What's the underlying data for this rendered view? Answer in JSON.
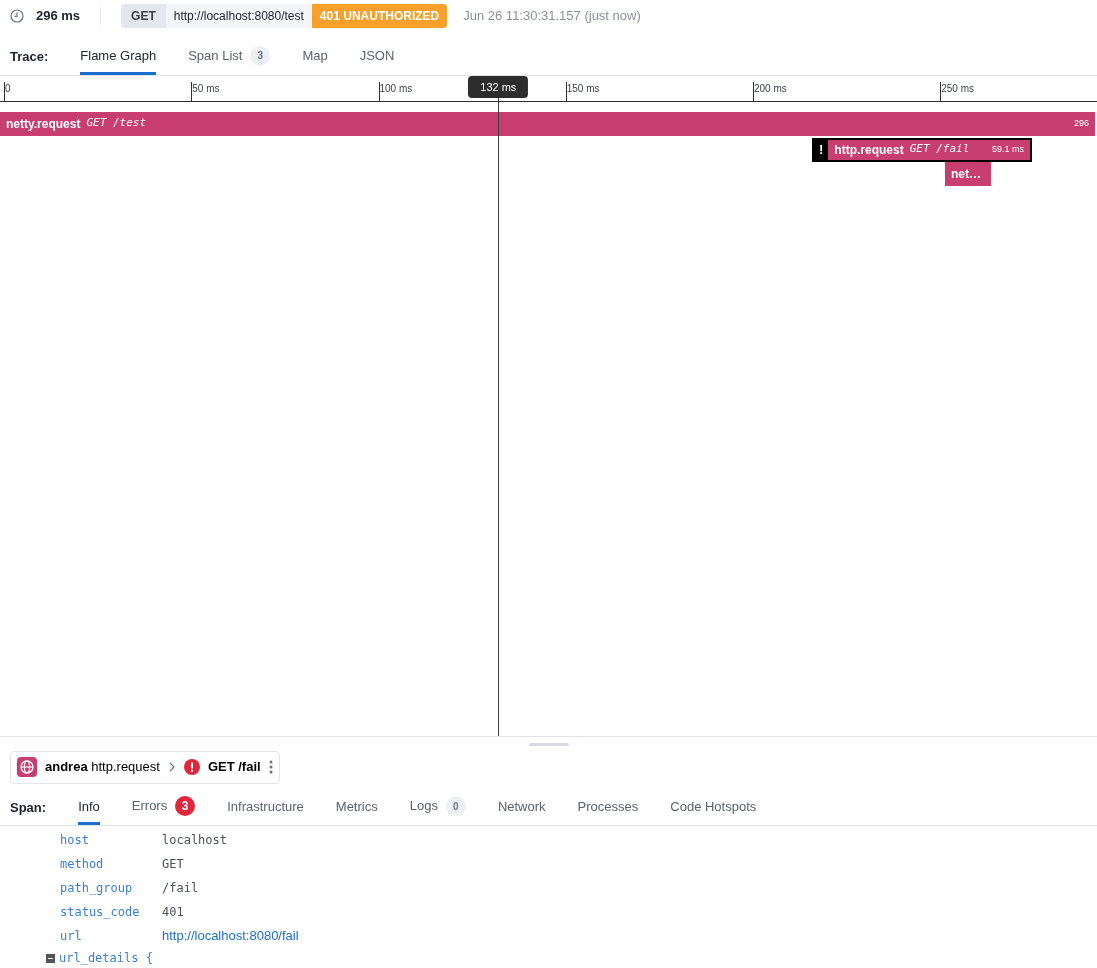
{
  "summary": {
    "duration": "296 ms",
    "method": "GET",
    "url": "http://localhost:8080/test",
    "status": "401 UNAUTHORIZED",
    "timestamp": "Jun 26 11:30:31.157 (just now)"
  },
  "trace_tabs": {
    "label": "Trace:",
    "tabs": [
      {
        "label": "Flame Graph",
        "selected": true
      },
      {
        "label": "Span List",
        "count": "3",
        "selected": false
      },
      {
        "label": "Map",
        "selected": false
      },
      {
        "label": "JSON",
        "selected": false
      }
    ]
  },
  "ruler": {
    "ticks": [
      "0",
      "50 ms",
      "100 ms",
      "150 ms",
      "200 ms",
      "250 ms"
    ],
    "cursor": "132 ms"
  },
  "spans": [
    {
      "name": "netty.request",
      "resource": "GET /test",
      "duration": "296",
      "error": false,
      "children": [
        {
          "name": "http.request",
          "resource": "GET /fail",
          "duration": "59.1 ms",
          "error": true,
          "error_mark": "!",
          "children": [
            {
              "name": "net…",
              "error": false
            }
          ]
        }
      ]
    }
  ],
  "span_header": {
    "service": "andrea",
    "operation": "http.request",
    "resource": "GET /fail",
    "error": true
  },
  "span_tabs": {
    "label": "Span:",
    "tabs": [
      {
        "label": "Info",
        "selected": true
      },
      {
        "label": "Errors",
        "count": "3",
        "alert": true,
        "selected": false
      },
      {
        "label": "Infrastructure",
        "selected": false
      },
      {
        "label": "Metrics",
        "selected": false
      },
      {
        "label": "Logs",
        "count": "0",
        "alert": false,
        "selected": false
      },
      {
        "label": "Network",
        "selected": false
      },
      {
        "label": "Processes",
        "selected": false
      },
      {
        "label": "Code Hotspots",
        "selected": false
      }
    ]
  },
  "attributes": [
    {
      "key": "host",
      "value": "localhost",
      "kind": "text"
    },
    {
      "key": "method",
      "value": "GET",
      "kind": "text"
    },
    {
      "key": "path_group",
      "value": "/fail",
      "kind": "text"
    },
    {
      "key": "status_code",
      "value": "401",
      "kind": "text"
    },
    {
      "key": "url",
      "value": "http://localhost:8080/fail",
      "kind": "link"
    }
  ],
  "collapsed_group": {
    "key": "url_details {",
    "expanded": true
  }
}
